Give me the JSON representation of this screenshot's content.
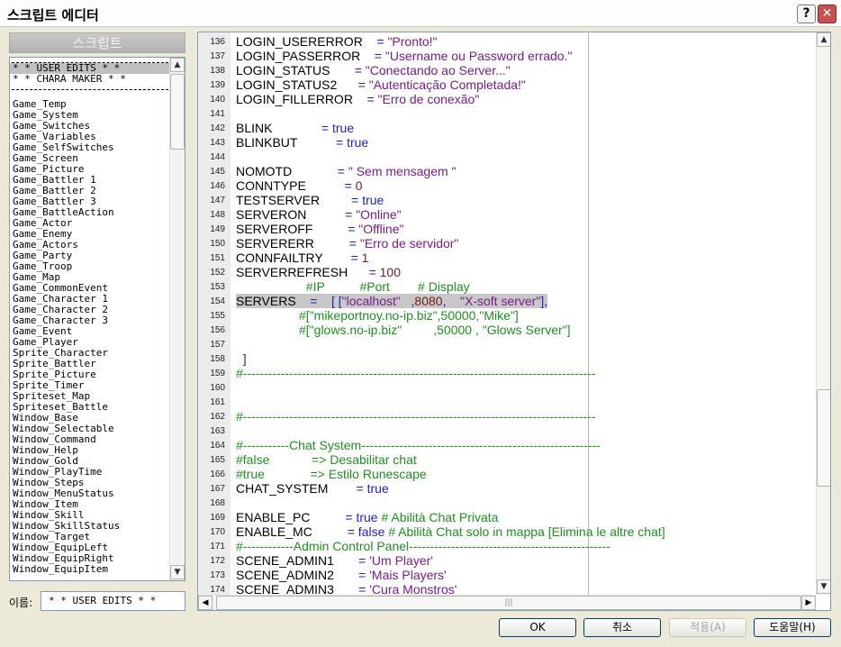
{
  "window": {
    "title": "스크립트 에디터",
    "help_symbol": "?",
    "close_symbol": "✕"
  },
  "sidebar": {
    "header": "스크립트",
    "items": [
      "* * USER EDITS * *",
      "* * CHARA MAKER * *",
      "",
      "Game_Temp",
      "Game_System",
      "Game_Switches",
      "Game_Variables",
      "Game_SelfSwitches",
      "Game_Screen",
      "Game_Picture",
      "Game_Battler 1",
      "Game_Battler 2",
      "Game_Battler 3",
      "Game_BattleAction",
      "Game_Actor",
      "Game_Enemy",
      "Game_Actors",
      "Game_Party",
      "Game_Troop",
      "Game_Map",
      "Game_CommonEvent",
      "Game_Character 1",
      "Game_Character 2",
      "Game_Character 3",
      "Game_Event",
      "Game_Player",
      "Sprite_Character",
      "Sprite_Battler",
      "Sprite_Picture",
      "Sprite_Timer",
      "Spriteset_Map",
      "Spriteset_Battle",
      "Window_Base",
      "Window_Selectable",
      "Window_Command",
      "Window_Help",
      "Window_Gold",
      "Window_PlayTime",
      "Window_Steps",
      "Window_MenuStatus",
      "Window_Item",
      "Window_Skill",
      "Window_SkillStatus",
      "Window_Target",
      "Window_EquipLeft",
      "Window_EquipRight",
      "Window_EquipItem"
    ],
    "selected_index": 0,
    "name_label": "이름:",
    "name_value": "* * USER EDITS * *"
  },
  "editor": {
    "lines": [
      {
        "n": "136",
        "t": "LOGIN_USERERROR    = \"Pronto!\""
      },
      {
        "n": "137",
        "t": "LOGIN_PASSERROR    = \"Username ou Password errado.\""
      },
      {
        "n": "138",
        "t": "LOGIN_STATUS       = \"Conectando ao Server...\""
      },
      {
        "n": "139",
        "t": "LOGIN_STATUS2      = \"Autenticação Completada!\""
      },
      {
        "n": "140",
        "t": "LOGIN_FILLERROR    = \"Erro de conexão\""
      },
      {
        "n": "141",
        "t": ""
      },
      {
        "n": "142",
        "t": "BLINK              = true"
      },
      {
        "n": "143",
        "t": "BLINKBUT           = true"
      },
      {
        "n": "144",
        "t": ""
      },
      {
        "n": "145",
        "t": "NOMOTD             = \" Sem mensagem \""
      },
      {
        "n": "146",
        "t": "CONNTYPE           = 0"
      },
      {
        "n": "147",
        "t": "TESTSERVER         = true"
      },
      {
        "n": "148",
        "t": "SERVERON           = \"Online\""
      },
      {
        "n": "149",
        "t": "SERVEROFF          = \"Offline\""
      },
      {
        "n": "150",
        "t": "SERVERERR          = \"Erro de servidor\""
      },
      {
        "n": "151",
        "t": "CONNFAILTRY        = 1"
      },
      {
        "n": "152",
        "t": "SERVERREFRESH      = 100"
      },
      {
        "n": "153",
        "t": "                    #IP          #Port        # Display"
      },
      {
        "n": "154",
        "t": "SERVERS    =    [ [\"localhost\"   ,8080,    \"X-soft server\"],"
      },
      {
        "n": "155",
        "t": "                  #[\"mikeportnoy.no-ip.biz\",50000,\"Mike\"]"
      },
      {
        "n": "156",
        "t": "                  #[\"glows.no-ip.biz\"         ,50000 , \"Glows Server\"]"
      },
      {
        "n": "157",
        "t": ""
      },
      {
        "n": "158",
        "t": "  ]"
      },
      {
        "n": "159",
        "t": "#------------------------------------------------------------------------------------"
      },
      {
        "n": "160",
        "t": ""
      },
      {
        "n": "161",
        "t": ""
      },
      {
        "n": "162",
        "t": "#------------------------------------------------------------------------------------"
      },
      {
        "n": "163",
        "t": ""
      },
      {
        "n": "164",
        "t": "#-----------Chat System---------------------------------------------------------"
      },
      {
        "n": "165",
        "t": "#false            => Desabilitar chat"
      },
      {
        "n": "166",
        "t": "#true             => Estilo Runescape"
      },
      {
        "n": "167",
        "t": "CHAT_SYSTEM        = true"
      },
      {
        "n": "168",
        "t": ""
      },
      {
        "n": "169",
        "t": "ENABLE_PC          = true # Abilità Chat Privata"
      },
      {
        "n": "170",
        "t": "ENABLE_MC          = false # Abilità Chat solo in mappa [Elimina le altre chat]"
      },
      {
        "n": "171",
        "t": "#------------Admin Control Panel------------------------------------------------"
      },
      {
        "n": "172",
        "t": "SCENE_ADMIN1       = 'Um Player'"
      },
      {
        "n": "173",
        "t": "SCENE_ADMIN2       = 'Mais Players'"
      },
      {
        "n": "174",
        "t": "SCENE_ADMIN3       = 'Cura Monstros'"
      }
    ],
    "highlight_line": "154"
  },
  "buttons": {
    "ok": "OK",
    "cancel": "취소",
    "apply": "적용(A)",
    "help": "도움말(H)"
  }
}
